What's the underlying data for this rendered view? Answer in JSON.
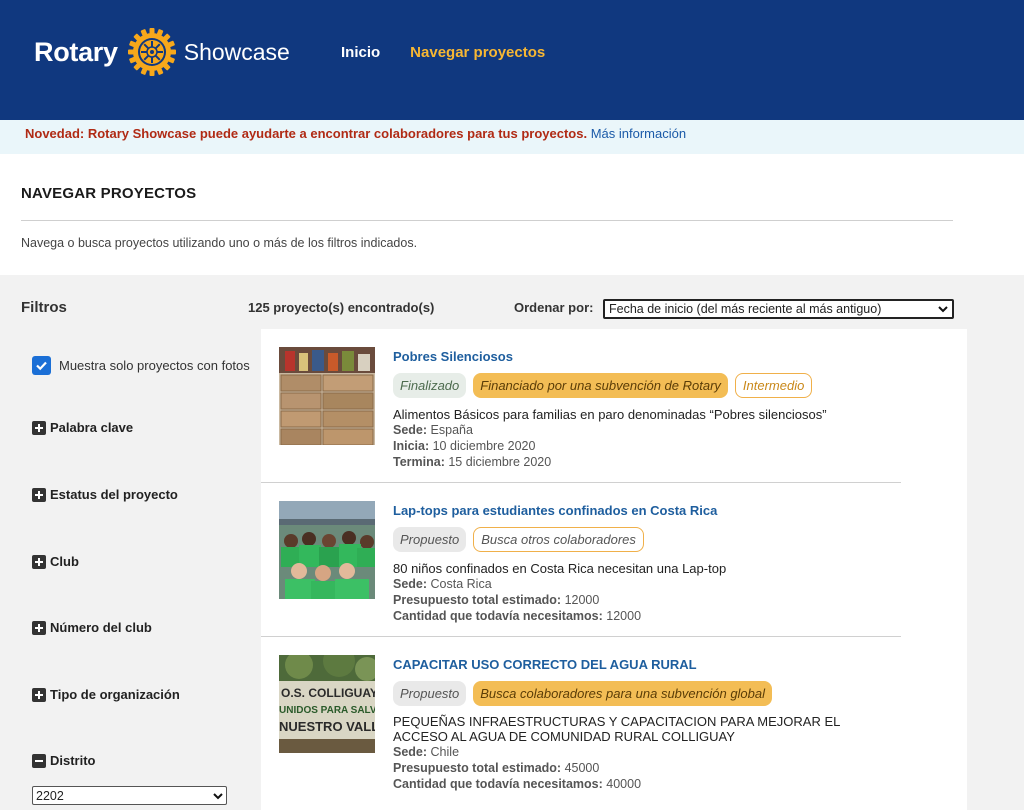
{
  "header": {
    "logo_left": "Rotary",
    "logo_right": "Showcase",
    "nav": [
      {
        "label": "Inicio"
      },
      {
        "label": "Navegar proyectos"
      }
    ],
    "bg_color": "#10387f",
    "active_color": "#f7b733"
  },
  "notice": {
    "strong_text": "Novedad: Rotary Showcase puede ayudarte a encontrar colaboradores para tus proyectos.",
    "link_text": "Más información"
  },
  "page": {
    "title": "NAVEGAR PROYECTOS",
    "description": "Navega o busca proyectos utilizando uno o más de los filtros indicados."
  },
  "filters": {
    "title": "Filtros",
    "photos_only_label": "Muestra solo proyectos con fotos",
    "photos_only_checked": true,
    "items": [
      {
        "label": "Palabra clave",
        "state": "collapsed"
      },
      {
        "label": "Estatus del proyecto",
        "state": "collapsed"
      },
      {
        "label": "Club",
        "state": "collapsed"
      },
      {
        "label": "Número del club",
        "state": "collapsed"
      },
      {
        "label": "Tipo de organización",
        "state": "collapsed"
      },
      {
        "label": "Distrito",
        "state": "expanded"
      }
    ],
    "district_value": "2202"
  },
  "results": {
    "count_text": "125 proyecto(s) encontrado(s)",
    "sort_label": "Ordenar por:",
    "sort_value": "Fecha de inicio (del más reciente al más antiguo)"
  },
  "projects": [
    {
      "title": "Pobres Silenciosos",
      "tags": [
        "Finalizado",
        "Financiado por una subvención de Rotary",
        "Intermedio"
      ],
      "description": "Alimentos Básicos para familias en paro denominadas “Pobres silenciosos”",
      "meta": [
        {
          "label": "Sede:",
          "value": "España"
        },
        {
          "label": "Inicia:",
          "value": "10 diciembre 2020"
        },
        {
          "label": "Termina:",
          "value": "15 diciembre 2020"
        }
      ]
    },
    {
      "title": "Lap-tops para estudiantes confinados en Costa Rica",
      "tags": [
        "Propuesto",
        "Busca otros colaboradores"
      ],
      "description": "80 niños confinados en Costa Rica necesitan una Lap-top",
      "meta": [
        {
          "label": "Sede:",
          "value": "Costa Rica"
        },
        {
          "label": "Presupuesto total estimado:",
          "value": "12000"
        },
        {
          "label": "Cantidad que todavía necesitamos:",
          "value": "12000"
        }
      ]
    },
    {
      "title": "CAPACITAR USO CORRECTO DEL AGUA RURAL",
      "tags": [
        "Propuesto",
        "Busca colaboradores para una subvención global"
      ],
      "description": "PEQUEÑAS INFRAESTRUCTURAS Y CAPACITACION PARA MEJORAR EL ACCESO AL AGUA DE COMUNIDAD RURAL COLLIGUAY",
      "meta": [
        {
          "label": "Sede:",
          "value": "Chile"
        },
        {
          "label": "Presupuesto total estimado:",
          "value": "45000"
        },
        {
          "label": "Cantidad que todavía necesitamos:",
          "value": "40000"
        }
      ],
      "image_sign_lines": [
        "O.S. COLLIGUAY",
        "UNIDOS PARA SALVA",
        "NUESTRO VALLE"
      ]
    }
  ]
}
